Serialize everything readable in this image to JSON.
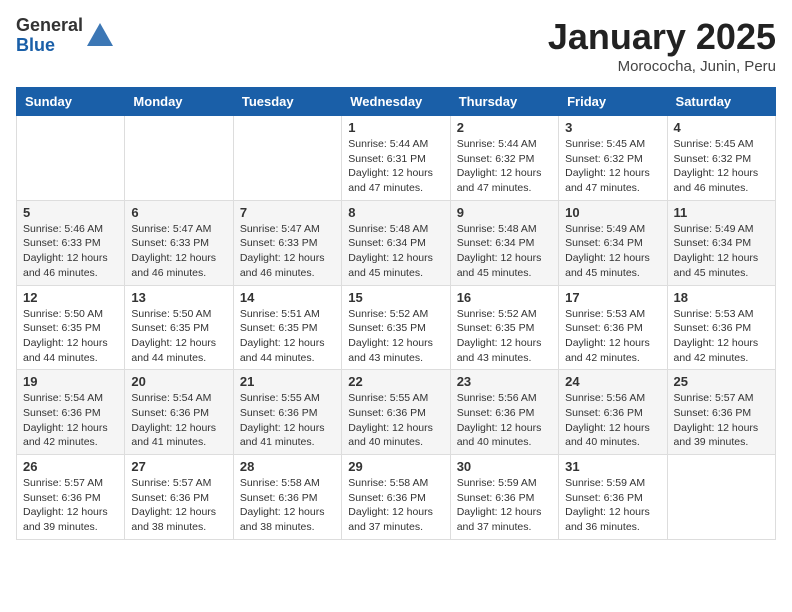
{
  "logo": {
    "general": "General",
    "blue": "Blue"
  },
  "header": {
    "month": "January 2025",
    "location": "Morococha, Junin, Peru"
  },
  "weekdays": [
    "Sunday",
    "Monday",
    "Tuesday",
    "Wednesday",
    "Thursday",
    "Friday",
    "Saturday"
  ],
  "weeks": [
    [
      {
        "day": "",
        "info": ""
      },
      {
        "day": "",
        "info": ""
      },
      {
        "day": "",
        "info": ""
      },
      {
        "day": "1",
        "info": "Sunrise: 5:44 AM\nSunset: 6:31 PM\nDaylight: 12 hours\nand 47 minutes."
      },
      {
        "day": "2",
        "info": "Sunrise: 5:44 AM\nSunset: 6:32 PM\nDaylight: 12 hours\nand 47 minutes."
      },
      {
        "day": "3",
        "info": "Sunrise: 5:45 AM\nSunset: 6:32 PM\nDaylight: 12 hours\nand 47 minutes."
      },
      {
        "day": "4",
        "info": "Sunrise: 5:45 AM\nSunset: 6:32 PM\nDaylight: 12 hours\nand 46 minutes."
      }
    ],
    [
      {
        "day": "5",
        "info": "Sunrise: 5:46 AM\nSunset: 6:33 PM\nDaylight: 12 hours\nand 46 minutes."
      },
      {
        "day": "6",
        "info": "Sunrise: 5:47 AM\nSunset: 6:33 PM\nDaylight: 12 hours\nand 46 minutes."
      },
      {
        "day": "7",
        "info": "Sunrise: 5:47 AM\nSunset: 6:33 PM\nDaylight: 12 hours\nand 46 minutes."
      },
      {
        "day": "8",
        "info": "Sunrise: 5:48 AM\nSunset: 6:34 PM\nDaylight: 12 hours\nand 45 minutes."
      },
      {
        "day": "9",
        "info": "Sunrise: 5:48 AM\nSunset: 6:34 PM\nDaylight: 12 hours\nand 45 minutes."
      },
      {
        "day": "10",
        "info": "Sunrise: 5:49 AM\nSunset: 6:34 PM\nDaylight: 12 hours\nand 45 minutes."
      },
      {
        "day": "11",
        "info": "Sunrise: 5:49 AM\nSunset: 6:34 PM\nDaylight: 12 hours\nand 45 minutes."
      }
    ],
    [
      {
        "day": "12",
        "info": "Sunrise: 5:50 AM\nSunset: 6:35 PM\nDaylight: 12 hours\nand 44 minutes."
      },
      {
        "day": "13",
        "info": "Sunrise: 5:50 AM\nSunset: 6:35 PM\nDaylight: 12 hours\nand 44 minutes."
      },
      {
        "day": "14",
        "info": "Sunrise: 5:51 AM\nSunset: 6:35 PM\nDaylight: 12 hours\nand 44 minutes."
      },
      {
        "day": "15",
        "info": "Sunrise: 5:52 AM\nSunset: 6:35 PM\nDaylight: 12 hours\nand 43 minutes."
      },
      {
        "day": "16",
        "info": "Sunrise: 5:52 AM\nSunset: 6:35 PM\nDaylight: 12 hours\nand 43 minutes."
      },
      {
        "day": "17",
        "info": "Sunrise: 5:53 AM\nSunset: 6:36 PM\nDaylight: 12 hours\nand 42 minutes."
      },
      {
        "day": "18",
        "info": "Sunrise: 5:53 AM\nSunset: 6:36 PM\nDaylight: 12 hours\nand 42 minutes."
      }
    ],
    [
      {
        "day": "19",
        "info": "Sunrise: 5:54 AM\nSunset: 6:36 PM\nDaylight: 12 hours\nand 42 minutes."
      },
      {
        "day": "20",
        "info": "Sunrise: 5:54 AM\nSunset: 6:36 PM\nDaylight: 12 hours\nand 41 minutes."
      },
      {
        "day": "21",
        "info": "Sunrise: 5:55 AM\nSunset: 6:36 PM\nDaylight: 12 hours\nand 41 minutes."
      },
      {
        "day": "22",
        "info": "Sunrise: 5:55 AM\nSunset: 6:36 PM\nDaylight: 12 hours\nand 40 minutes."
      },
      {
        "day": "23",
        "info": "Sunrise: 5:56 AM\nSunset: 6:36 PM\nDaylight: 12 hours\nand 40 minutes."
      },
      {
        "day": "24",
        "info": "Sunrise: 5:56 AM\nSunset: 6:36 PM\nDaylight: 12 hours\nand 40 minutes."
      },
      {
        "day": "25",
        "info": "Sunrise: 5:57 AM\nSunset: 6:36 PM\nDaylight: 12 hours\nand 39 minutes."
      }
    ],
    [
      {
        "day": "26",
        "info": "Sunrise: 5:57 AM\nSunset: 6:36 PM\nDaylight: 12 hours\nand 39 minutes."
      },
      {
        "day": "27",
        "info": "Sunrise: 5:57 AM\nSunset: 6:36 PM\nDaylight: 12 hours\nand 38 minutes."
      },
      {
        "day": "28",
        "info": "Sunrise: 5:58 AM\nSunset: 6:36 PM\nDaylight: 12 hours\nand 38 minutes."
      },
      {
        "day": "29",
        "info": "Sunrise: 5:58 AM\nSunset: 6:36 PM\nDaylight: 12 hours\nand 37 minutes."
      },
      {
        "day": "30",
        "info": "Sunrise: 5:59 AM\nSunset: 6:36 PM\nDaylight: 12 hours\nand 37 minutes."
      },
      {
        "day": "31",
        "info": "Sunrise: 5:59 AM\nSunset: 6:36 PM\nDaylight: 12 hours\nand 36 minutes."
      },
      {
        "day": "",
        "info": ""
      }
    ]
  ]
}
